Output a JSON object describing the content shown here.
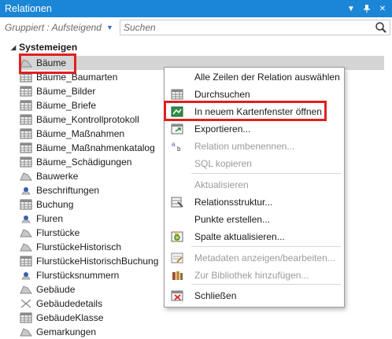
{
  "panel": {
    "title": "Relationen"
  },
  "toolbar": {
    "group_label": "Gruppiert : Aufsteigend",
    "search_placeholder": "Suchen"
  },
  "tree": {
    "group_name": "Systemeigen",
    "items": [
      {
        "label": "Bäume",
        "icon": "shape-icon"
      },
      {
        "label": "Bäume_Baumarten",
        "icon": "table-icon"
      },
      {
        "label": "Bäume_Bilder",
        "icon": "table-icon"
      },
      {
        "label": "Bäume_Briefe",
        "icon": "table-icon"
      },
      {
        "label": "Bäume_Kontrollprotokoll",
        "icon": "table-icon"
      },
      {
        "label": "Bäume_Maßnahmen",
        "icon": "table-icon"
      },
      {
        "label": "Bäume_Maßnahmenkatalog",
        "icon": "table-icon"
      },
      {
        "label": "Bäume_Schädigungen",
        "icon": "table-icon"
      },
      {
        "label": "Bauwerke",
        "icon": "shape-icon"
      },
      {
        "label": "Beschriftungen",
        "icon": "point-icon"
      },
      {
        "label": "Buchung",
        "icon": "table-icon"
      },
      {
        "label": "Fluren",
        "icon": "point-icon"
      },
      {
        "label": "Flurstücke",
        "icon": "shape-icon"
      },
      {
        "label": "FlurstückeHistorisch",
        "icon": "shape-icon"
      },
      {
        "label": "FlurstückeHistorischBuchung",
        "icon": "table-icon"
      },
      {
        "label": "Flurstücksnummern",
        "icon": "point-icon"
      },
      {
        "label": "Gebäude",
        "icon": "shape-icon"
      },
      {
        "label": "Gebäudedetails",
        "icon": "line-icon"
      },
      {
        "label": "GebäudeKlasse",
        "icon": "table-icon"
      },
      {
        "label": "Gemarkungen",
        "icon": "shape-icon"
      }
    ]
  },
  "context_menu": {
    "items": [
      {
        "label": "Alle Zeilen der Relation auswählen",
        "icon": "",
        "enabled": true
      },
      {
        "label": "Durchsuchen",
        "icon": "table-icon",
        "enabled": true
      },
      {
        "label": "In neuem Kartenfenster öffnen",
        "icon": "map-icon",
        "enabled": true
      },
      {
        "label": "Exportieren...",
        "icon": "export-icon",
        "enabled": true
      },
      {
        "label": "Relation umbenennen...",
        "icon": "rename-icon",
        "enabled": false
      },
      {
        "label": "SQL kopieren",
        "icon": "",
        "enabled": false
      },
      {
        "label": "Aktualisieren",
        "icon": "",
        "enabled": false
      },
      {
        "label": "Relationsstruktur...",
        "icon": "structure-icon",
        "enabled": true
      },
      {
        "label": "Punkte erstellen...",
        "icon": "",
        "enabled": true
      },
      {
        "label": "Spalte aktualisieren...",
        "icon": "update-column-icon",
        "enabled": true
      },
      {
        "label": "Metadaten anzeigen/bearbeiten...",
        "icon": "metadata-icon",
        "enabled": false
      },
      {
        "label": "Zur Bibliothek hinzufügen...",
        "icon": "library-icon",
        "enabled": false
      },
      {
        "label": "Schließen",
        "icon": "close-icon",
        "enabled": true
      }
    ]
  },
  "colors": {
    "titlebar": "#1c86d6",
    "highlight": "#e02020",
    "selection": "#d5d5d5"
  }
}
